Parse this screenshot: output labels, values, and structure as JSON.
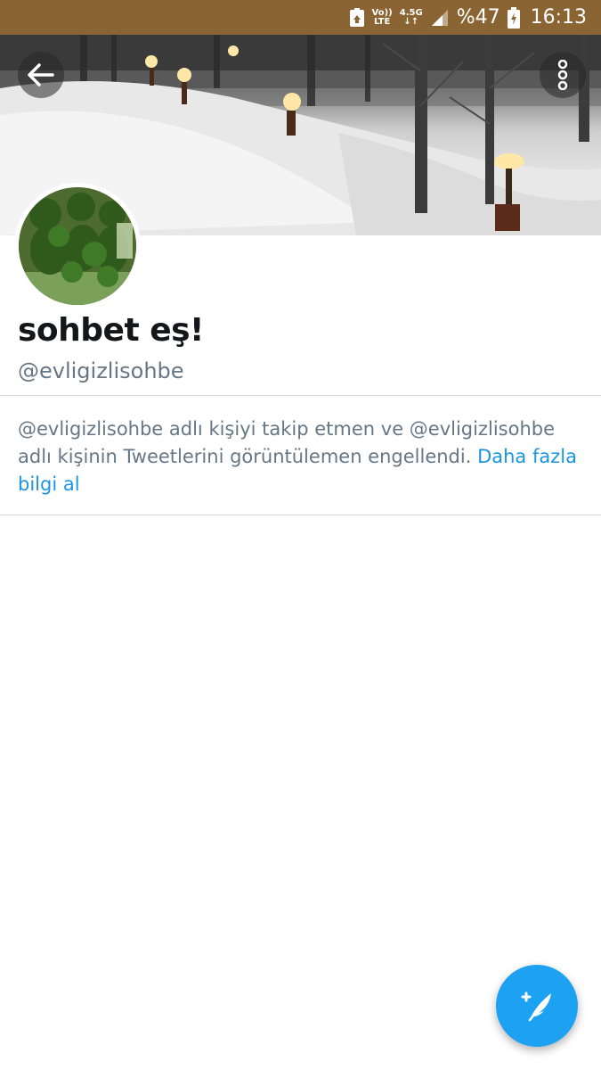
{
  "status_bar": {
    "volte_top": "Vo))",
    "volte_bottom": "LTE",
    "network_top": "4.5G",
    "network_bottom": "↓↑",
    "battery": "%47",
    "time": "16:13",
    "background_color": "#8a6533"
  },
  "header": {
    "back_icon": "arrow-left-icon",
    "more_icon": "more-vertical-icon"
  },
  "profile": {
    "display_name": "sohbet eş!",
    "handle": "@evligizlisohbe"
  },
  "blocked_notice": {
    "message": "@evligizlisohbe adlı kişiyi takip etmen ve @evligizlisohbe adlı kişinin Tweetlerini görüntülemen engellendi. ",
    "link_text": "Daha fazla bilgi al",
    "link_color": "#1b95e0"
  },
  "compose_fab": {
    "icon": "compose-tweet-icon",
    "color": "#1da1f2"
  }
}
